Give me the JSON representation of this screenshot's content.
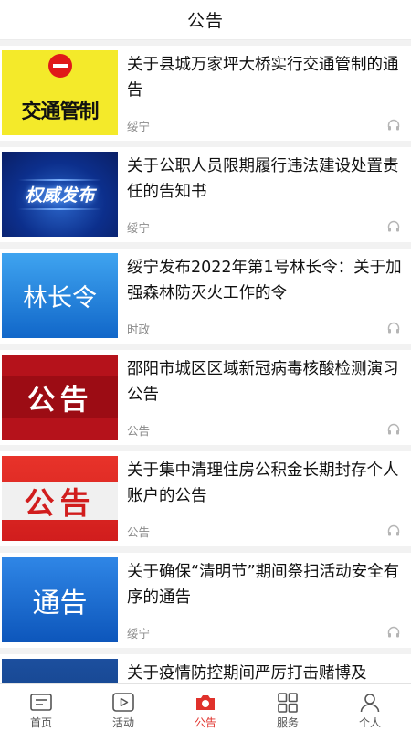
{
  "header": {
    "title": "公告"
  },
  "feed": {
    "items": [
      {
        "title": "关于县城万家坪大桥实行交通管制的通告",
        "source": "绥宁",
        "thumb_text": "交通管制"
      },
      {
        "title": "关于公职人员限期履行违法建设处置责任的告知书",
        "source": "绥宁",
        "thumb_text": "权威发布"
      },
      {
        "title": "绥宁发布2022年第1号林长令：关于加强森林防灭火工作的令",
        "source": "时政",
        "thumb_text": "林长令"
      },
      {
        "title": "邵阳市城区区域新冠病毒核酸检测演习公告",
        "source": "公告",
        "thumb_text": "公告"
      },
      {
        "title": "关于集中清理住房公积金长期封存个人账户的公告",
        "source": "公告",
        "thumb_text": "公告"
      },
      {
        "title": "关于确保“清明节”期间祭扫活动安全有序的通告",
        "source": "绥宁",
        "thumb_text": "通告"
      },
      {
        "title": "关于疫情防控期间严厉打击赌博及",
        "source": "",
        "thumb_text": ""
      }
    ]
  },
  "tabbar": {
    "tabs": [
      {
        "label": "首页",
        "icon": "home-icon"
      },
      {
        "label": "活动",
        "icon": "play-icon"
      },
      {
        "label": "公告",
        "icon": "camera-icon"
      },
      {
        "label": "服务",
        "icon": "grid-icon"
      },
      {
        "label": "个人",
        "icon": "person-icon"
      }
    ],
    "active_index": 2
  },
  "colors": {
    "accent": "#e0312b",
    "text": "#111111",
    "meta": "#8a8a8a"
  }
}
